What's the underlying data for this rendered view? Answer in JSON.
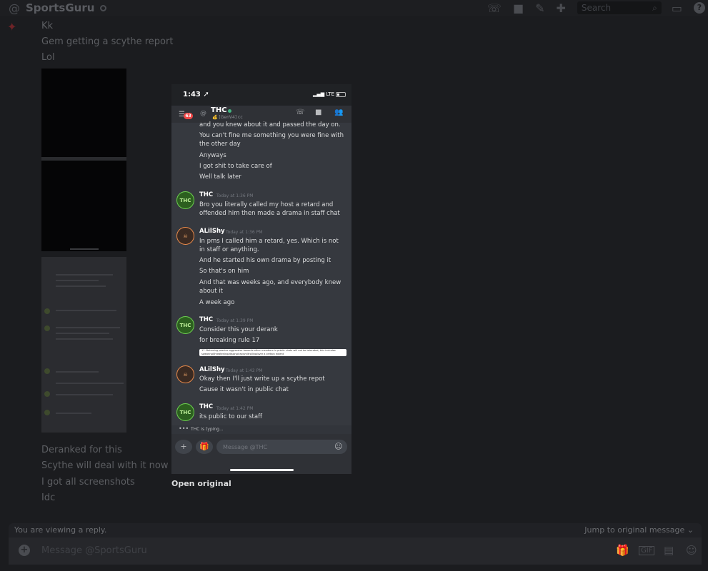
{
  "topbar": {
    "channel": "SportsGuru",
    "search_placeholder": "Search"
  },
  "icons": {
    "at": "at-icon",
    "call": "phone-call-icon",
    "video": "video-icon",
    "pin": "pin-icon",
    "add_friend": "add-friend-icon",
    "search": "search-icon",
    "inbox": "inbox-icon",
    "help": "help-icon"
  },
  "background_messages": {
    "top": [
      "Kk",
      "Gem getting a scythe report",
      "Lol"
    ],
    "bottom": [
      "Deranked for this",
      "Scythe will deal with it now",
      "I got all screenshots",
      "Idc"
    ]
  },
  "reply": {
    "label": "You are viewing a reply.",
    "jump": "Jump to original message"
  },
  "composer": {
    "placeholder": "Message @SportsGuru"
  },
  "phone": {
    "time": "1:43",
    "network": "LTE",
    "header": {
      "unread": "63",
      "name": "THC",
      "sub": "[GenV4] cc"
    },
    "messages": [
      {
        "author": "",
        "time": "",
        "lines": [
          "and you knew about it and passed the day on.",
          "You can't fine me something you were fine with the other day",
          "Anyways",
          "I got shit to take care of",
          "Well talk later"
        ]
      },
      {
        "author": "THC",
        "time": "Today at 1:36 PM",
        "lines": [
          "Bro you literally called my host a retard and offended him then made a drama in staff chat"
        ]
      },
      {
        "author": "ALilShy",
        "time": "Today at 1:36 PM",
        "lines": [
          "In pms I called him a retard, yes. Which is not in staff or anything.",
          "And he started his own drama by posting it",
          "So that's on him",
          "And that was weeks ago, and everybody knew about it",
          "A week ago"
        ]
      },
      {
        "author": "THC",
        "time": "Today at 1:39 PM",
        "lines": [
          "Consider this your derank",
          "for breaking rule 17"
        ]
      },
      {
        "author": "ALilShy",
        "time": "Today at 1:42 PM",
        "lines": [
          "Okay then I'll just write up a scythe repot",
          "Cause it wasn't in public chat"
        ]
      },
      {
        "author": "THC",
        "time": "Today at 1:42 PM",
        "lines": [
          "its public to our staff"
        ]
      }
    ],
    "embed_text": "17. Behaving passive aggressive towards other members in public chats will not be tolerated, this includes swearing/threatening/dissing/racism/trolling/over a certain extent",
    "typing": "THC is typing...",
    "input_placeholder": "Message @THC"
  },
  "open_original": "Open original"
}
